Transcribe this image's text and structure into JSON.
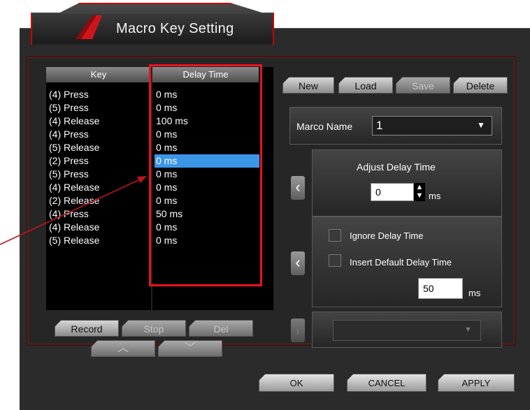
{
  "title": "Macro Key Setting",
  "list": {
    "headers": {
      "key": "Key",
      "delay": "Delay Time"
    },
    "rows": [
      {
        "key": "(4) Press",
        "delay": "0 ms"
      },
      {
        "key": "(5) Press",
        "delay": "0 ms"
      },
      {
        "key": "(4) Release",
        "delay": "100 ms"
      },
      {
        "key": "(4) Press",
        "delay": "0 ms"
      },
      {
        "key": "(5) Release",
        "delay": "0 ms"
      },
      {
        "key": "(2) Press",
        "delay": "0 ms"
      },
      {
        "key": "(5) Press",
        "delay": "0 ms"
      },
      {
        "key": "(4) Release",
        "delay": "0 ms"
      },
      {
        "key": "(2) Release",
        "delay": "0 ms"
      },
      {
        "key": "(4) Press",
        "delay": "50 ms"
      },
      {
        "key": "(4) Release",
        "delay": "0 ms"
      },
      {
        "key": "(5) Release",
        "delay": "0 ms"
      }
    ]
  },
  "list_buttons": {
    "record": "Record",
    "stop": "Stop",
    "del": "Del"
  },
  "top_buttons": {
    "new": "New",
    "load": "Load",
    "save": "Save",
    "delete": "Delete"
  },
  "macro_name": {
    "label": "Marco Name",
    "value": "1"
  },
  "adjust": {
    "title": "Adjust Delay Time",
    "value": "0",
    "unit": "ms"
  },
  "options": {
    "ignore": "Ignore Delay Time",
    "insert_default": "Insert Default Delay Time",
    "default_value": "50",
    "unit": "ms"
  },
  "footer": {
    "ok": "OK",
    "cancel": "CANCEL",
    "apply": "APPLY"
  },
  "colors": {
    "highlight": "#e8141c",
    "selection": "#3c96e8"
  }
}
